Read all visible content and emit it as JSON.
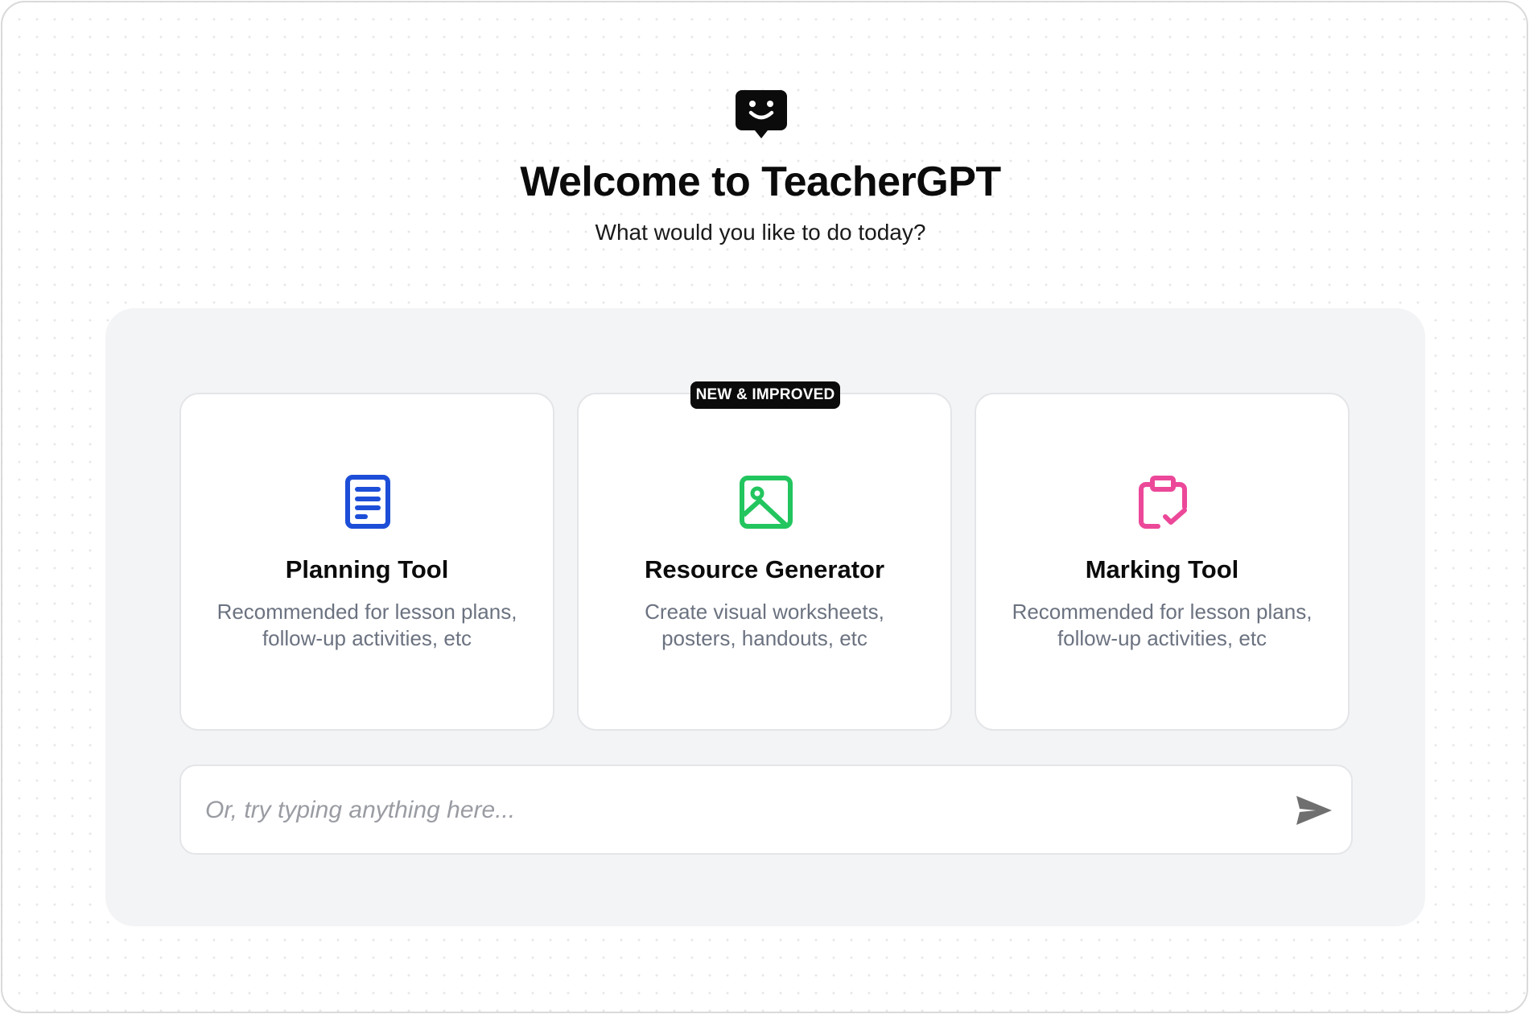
{
  "header": {
    "logo_icon": "chat-smiley-icon",
    "title": "Welcome to TeacherGPT",
    "subtitle": "What would you like to do today?"
  },
  "cards": [
    {
      "icon": "document-list-icon",
      "icon_color": "#1d4ed8",
      "title": "Planning Tool",
      "description": "Recommended for lesson plans, follow-up activities, etc"
    },
    {
      "icon": "image-icon",
      "icon_color": "#22c55e",
      "title": "Resource Generator",
      "description": "Create visual worksheets, posters, handouts, etc",
      "badge": "NEW & IMPROVED"
    },
    {
      "icon": "clipboard-check-icon",
      "icon_color": "#ec4899",
      "title": "Marking Tool",
      "description": "Recommended for lesson plans, follow-up activities, etc"
    }
  ],
  "prompt": {
    "placeholder": "Or, try typing anything here...",
    "send_icon": "send-icon"
  }
}
